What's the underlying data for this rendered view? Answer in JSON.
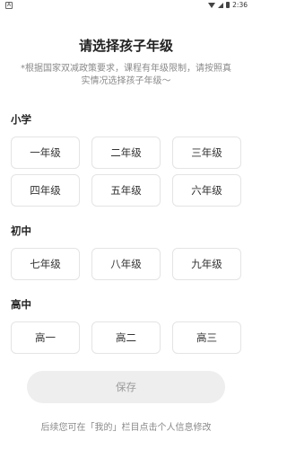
{
  "status_bar": {
    "left_icon": "A",
    "time": "2:36"
  },
  "title": "请选择孩子年级",
  "subtitle": "*根据国家双减政策要求，课程有年级限制，请按照真实情况选择孩子年级～",
  "sections": [
    {
      "label": "小学",
      "grades": [
        "一年级",
        "二年级",
        "三年级",
        "四年级",
        "五年级",
        "六年级"
      ]
    },
    {
      "label": "初中",
      "grades": [
        "七年级",
        "八年级",
        "九年级"
      ]
    },
    {
      "label": "高中",
      "grades": [
        "高一",
        "高二",
        "高三"
      ]
    }
  ],
  "save_label": "保存",
  "footer": "后续您可在「我的」栏目点击个人信息修改",
  "colors": {
    "button_border": "#e4e4e4",
    "save_bg": "#eeeeee",
    "save_text": "#9a9a9a",
    "hint_text": "#8a8a8a"
  }
}
